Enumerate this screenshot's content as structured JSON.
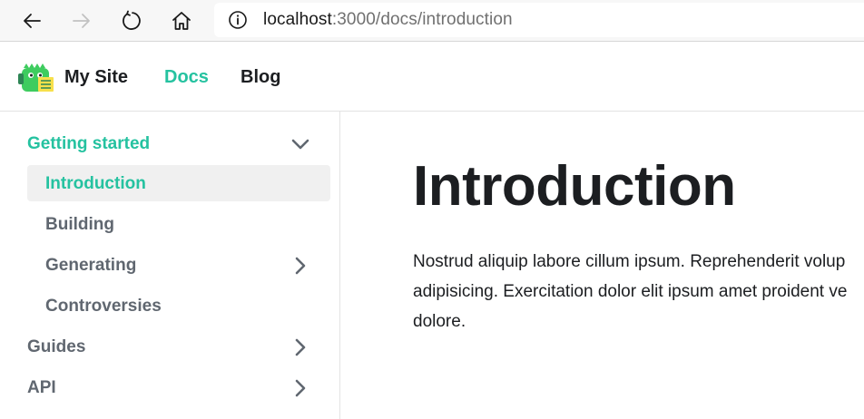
{
  "browser": {
    "back_icon": "arrow-left-icon",
    "forward_icon": "arrow-right-icon",
    "reload_icon": "reload-icon",
    "home_icon": "home-icon",
    "info_icon": "info-icon",
    "url_host": "localhost",
    "url_rest": ":3000/docs/introduction"
  },
  "navbar": {
    "logo_icon": "dinosaur-logo-icon",
    "brand": "My Site",
    "links": [
      {
        "label": "Docs",
        "active": true
      },
      {
        "label": "Blog",
        "active": false
      }
    ]
  },
  "sidebar": {
    "items": [
      {
        "label": "Getting started",
        "level": 0,
        "active_category": true,
        "caret": "chevron-down-icon"
      },
      {
        "label": "Introduction",
        "level": 1,
        "active": true
      },
      {
        "label": "Building",
        "level": 1
      },
      {
        "label": "Generating",
        "level": 1,
        "caret": "chevron-right-icon"
      },
      {
        "label": "Controversies",
        "level": 1
      },
      {
        "label": "Guides",
        "level": 0,
        "caret": "chevron-right-icon"
      },
      {
        "label": "API",
        "level": 0,
        "caret": "chevron-right-icon"
      }
    ]
  },
  "main": {
    "title": "Introduction",
    "paragraph_lines": [
      "Nostrud aliquip labore cillum ipsum. Reprehenderit volup",
      "adipisicing. Exercitation dolor elit ipsum amet proident ve",
      "dolore."
    ]
  },
  "colors": {
    "accent": "#25c2a0",
    "text": "#1c1e21",
    "sidebar_text": "#606770",
    "active_bg": "#f0f0f0"
  }
}
